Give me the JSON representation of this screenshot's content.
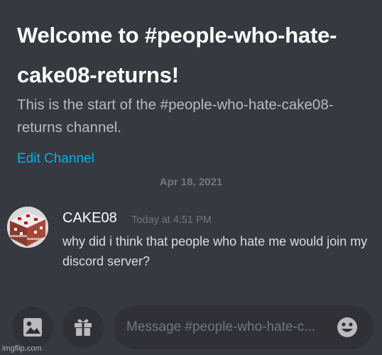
{
  "welcome": {
    "title": "Welcome to #people-who-hate-cake08-returns!",
    "subtitle": "This is the start of the #people-who-hate-cake08-returns channel.",
    "edit_channel_label": "Edit Channel"
  },
  "divider": {
    "date": "Apr 18, 2021"
  },
  "message": {
    "author": "CAKE08",
    "timestamp": "Today at 4:51 PM",
    "text": "why did i think that people who hate me would join my discord server?",
    "avatar_icon": "cake-avatar-icon"
  },
  "composer": {
    "placeholder": "Message #people-who-hate-c...",
    "image_icon": "image-icon",
    "gift_icon": "gift-icon",
    "emoji_icon": "emoji-icon"
  },
  "watermark": {
    "text": "imgflip.com"
  },
  "colors": {
    "background": "#36393f",
    "input_background": "#2f3136",
    "link": "#00b0f4",
    "heading": "#ffffff",
    "muted": "#72767d",
    "body_text": "#dcddde"
  }
}
